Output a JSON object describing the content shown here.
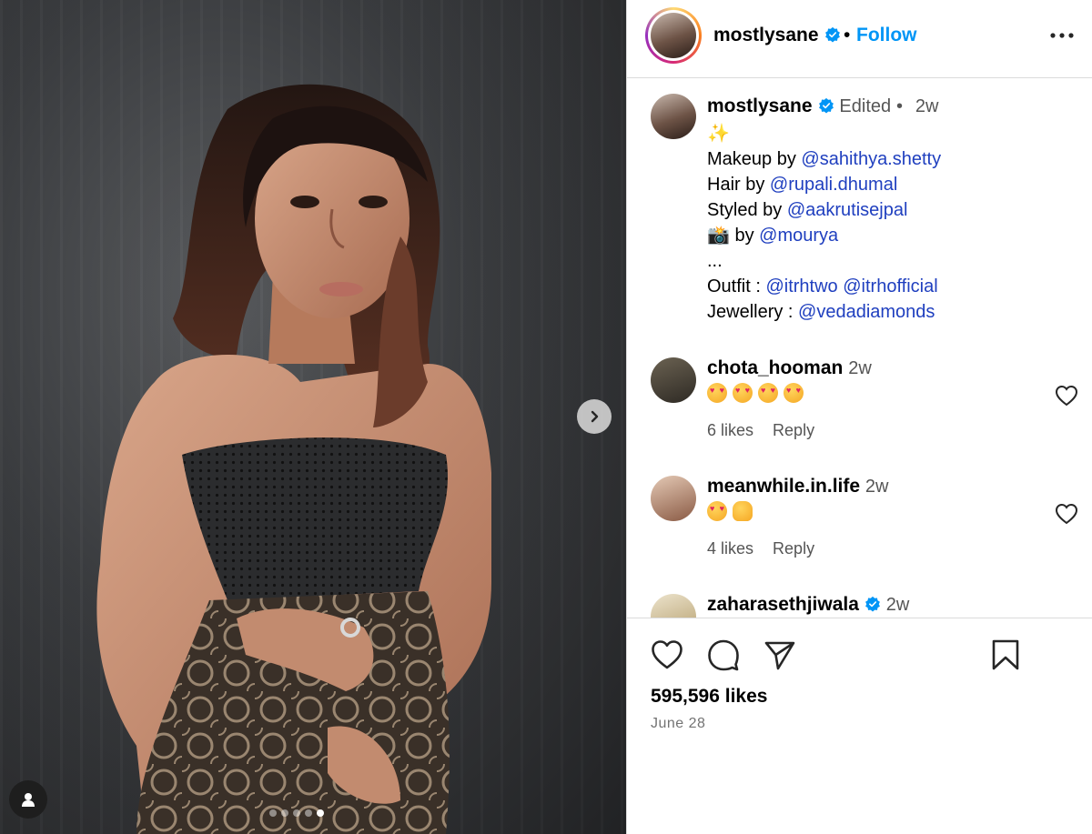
{
  "media": {
    "carousel_count": 5,
    "carousel_active_index": 4
  },
  "post": {
    "author": "mostlysane",
    "follow_label": "Follow",
    "separator": "•",
    "edited_label": "Edited",
    "time_ago": "2w",
    "caption_lines": {
      "sparkle": "✨",
      "makeup_prefix": "Makeup by ",
      "makeup_mention": "@sahithya.shetty",
      "hair_prefix": "Hair by ",
      "hair_mention": "@rupali.dhumal",
      "styled_prefix": "Styled by ",
      "styled_mention": "@aakrutisejpal",
      "camera_emoji": "📸",
      "camera_prefix": " by ",
      "camera_mention": "@mourya",
      "ellipsis": "...",
      "outfit_prefix": "Outfit : ",
      "outfit_mention_1": "@itrhtwo",
      "outfit_mention_2": "@itrhofficial",
      "jewellery_prefix": "Jewellery : ",
      "jewellery_mention": "@vedadiamonds"
    },
    "likes": "595,596 likes",
    "date": "June 28"
  },
  "comments": [
    {
      "user": "chota_hooman",
      "time": "2w",
      "likes": "6 likes",
      "reply": "Reply",
      "emojis": [
        "heart-eyes",
        "heart-eyes",
        "heart-eyes",
        "heart-eyes"
      ],
      "verified": false
    },
    {
      "user": "meanwhile.in.life",
      "time": "2w",
      "likes": "4 likes",
      "reply": "Reply",
      "emojis": [
        "heart-eyes",
        "raising-hands"
      ],
      "verified": false
    },
    {
      "user": "zaharasethjiwala",
      "time": "2w",
      "verified": true
    }
  ],
  "colors": {
    "link": "#0095f6",
    "mention": "#1f3fbf",
    "verified": "#0095f6",
    "border": "#dbdbdb",
    "muted": "#737373"
  }
}
